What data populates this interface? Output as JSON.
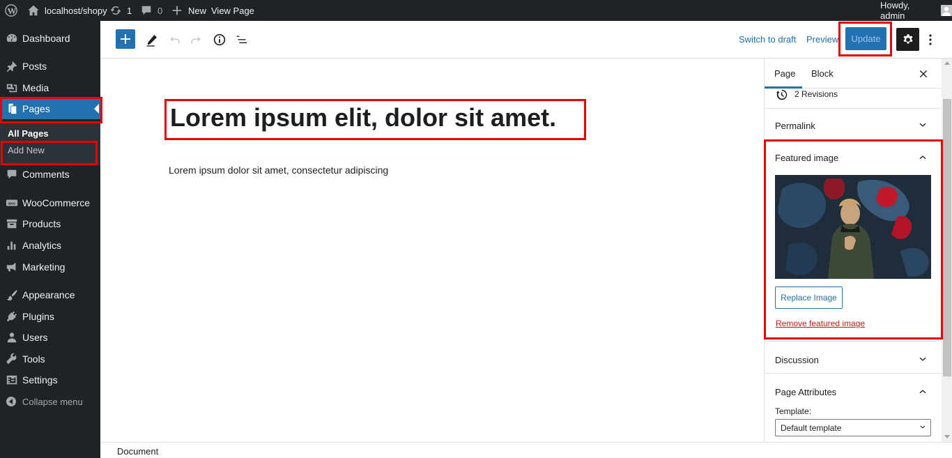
{
  "admin_bar": {
    "site_name": "localhost/shopy",
    "updates_count": "1",
    "comments_count": "0",
    "new_label": "New",
    "view_page_label": "View Page",
    "greeting": "Howdy, admin"
  },
  "admin_menu": {
    "items": [
      {
        "label": "Dashboard",
        "icon": "dashboard-icon"
      },
      {
        "label": "Posts",
        "icon": "pin-icon"
      },
      {
        "label": "Media",
        "icon": "media-icon"
      },
      {
        "label": "Pages",
        "icon": "pages-icon"
      },
      {
        "label": "Comments",
        "icon": "comment-icon"
      },
      {
        "label": "WooCommerce",
        "icon": "woo-icon"
      },
      {
        "label": "Products",
        "icon": "archive-icon"
      },
      {
        "label": "Analytics",
        "icon": "bar-chart-icon"
      },
      {
        "label": "Marketing",
        "icon": "megaphone-icon"
      },
      {
        "label": "Appearance",
        "icon": "brush-icon"
      },
      {
        "label": "Plugins",
        "icon": "plug-icon"
      },
      {
        "label": "Users",
        "icon": "users-icon"
      },
      {
        "label": "Tools",
        "icon": "wrench-icon"
      },
      {
        "label": "Settings",
        "icon": "settings-icon"
      }
    ],
    "submenu": {
      "all_pages": "All Pages",
      "add_new": "Add New"
    },
    "collapse_label": "Collapse menu"
  },
  "editor_header": {
    "switch_to_draft": "Switch to draft",
    "preview": "Preview",
    "update": "Update"
  },
  "content": {
    "title": "Lorem ipsum elit, dolor sit amet.",
    "paragraph": "Lorem ipsum dolor sit amet, consectetur adipiscing"
  },
  "footer": {
    "breadcrumb": "Document"
  },
  "settings_sidebar": {
    "tabs": [
      "Page",
      "Block"
    ],
    "active_tab": "Page",
    "revisions": "2 Revisions",
    "panels": {
      "permalink": "Permalink",
      "featured_image": "Featured image",
      "discussion": "Discussion",
      "page_attributes": "Page Attributes"
    },
    "replace_image": "Replace Image",
    "remove_featured_image": "Remove featured image",
    "template_label": "Template:",
    "template_value": "Default template"
  },
  "colors": {
    "admin_dark": "#1d2327",
    "accent_blue": "#2271b1",
    "highlight_red": "#e60000",
    "danger_red": "#cc1818"
  }
}
